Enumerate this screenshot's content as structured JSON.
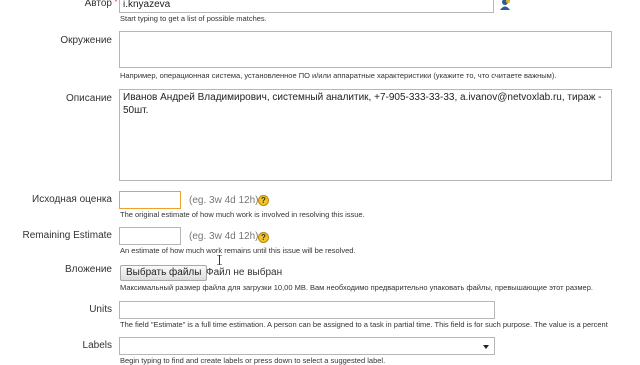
{
  "fields": {
    "author": {
      "label": "Автор",
      "required": "*",
      "value": "i.knyazeva",
      "help": "Start typing to get a list of possible matches."
    },
    "environment": {
      "label": "Окружение",
      "value": "",
      "help": "Например, операционная система, установленное ПО и/или аппаратные характеристики (укажите то, что считаете важным)."
    },
    "description": {
      "label": "Описание",
      "value": "Иванов Андрей Владимирович, системный аналитик, +7-905-333-33-33, a.ivanov@netvoxlab.ru, тираж - 50шт."
    },
    "original_estimate": {
      "label": "Исходная оценка",
      "value": "",
      "hint": "(eg. 3w 4d 12h)",
      "help_icon": "?",
      "help": "The original estimate of how much work is involved in resolving this issue."
    },
    "remaining_estimate": {
      "label": "Remaining Estimate",
      "value": "",
      "hint": "(eg. 3w 4d 12h)",
      "help_icon": "?",
      "help": "An estimate of how much work remains until this issue will be resolved."
    },
    "attachment": {
      "label": "Вложение",
      "button": "Выбрать файлы",
      "status": "Файл не выбран",
      "help": "Максимальный размер файла для загрузки 10,00 MB. Вам необходимо предварительно упаковать файлы, превышающие этот размер."
    },
    "units": {
      "label": "Units",
      "value": "",
      "help": "The field \"Estimate\" is a full time estimation. A person can be assigned to a task in partial time. This field is for such purpose. The value is a percent"
    },
    "labels": {
      "label": "Labels",
      "value": "",
      "help": "Begin typing to find and create labels or press down to select a suggested label."
    }
  },
  "icons": {
    "author_picker": "user-picker-icon",
    "estimate_help": "question-icon",
    "labels_dropdown": "chevron-down-icon"
  },
  "colors": {
    "required_star": "#d04437",
    "focus_border": "#f0a030",
    "help_icon": "#f4c427"
  }
}
